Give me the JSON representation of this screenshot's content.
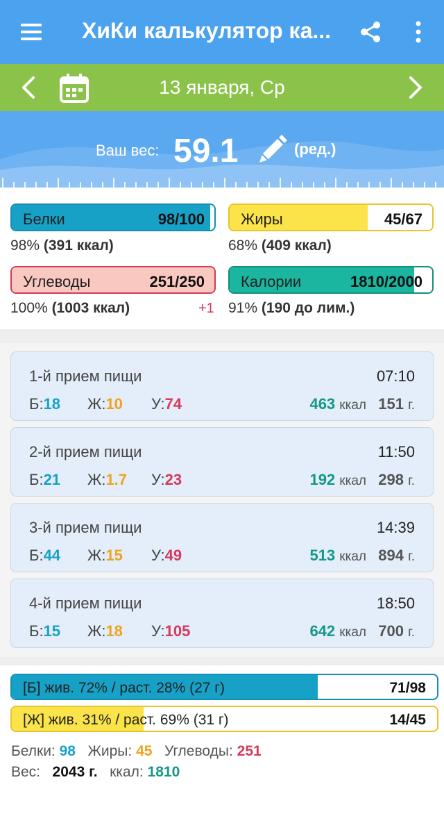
{
  "app": {
    "title": "ХиКи калькулятор ка...",
    "icons": {
      "menu": "hamburger-menu-icon",
      "share": "share-icon",
      "more": "more-vertical-icon"
    }
  },
  "datebar": {
    "date": "13 января, Ср",
    "icons": {
      "prev": "chevron-left-icon",
      "calendar": "calendar-icon",
      "next": "chevron-right-icon"
    }
  },
  "weight": {
    "label": "Ваш вес:",
    "value": "59.1",
    "edit_label": "(ред.)",
    "icon": "pencil-icon"
  },
  "nutrients": {
    "protein": {
      "label": "Белки",
      "value": "98/100",
      "sub_pct": "98%",
      "sub_kcal": "(391 ккал)",
      "fill_fraction": 0.98,
      "color": "#17a1c7"
    },
    "fat": {
      "label": "Жиры",
      "value": "45/67",
      "sub_pct": "68%",
      "sub_kcal": "(409 ккал)",
      "fill_fraction": 0.68,
      "color": "#fbe34a"
    },
    "carbs": {
      "label": "Углеводы",
      "value": "251/250",
      "sub_pct": "100%",
      "sub_kcal": "(1003 ккал)",
      "over": "+1",
      "fill_fraction": 1.0,
      "color": "#f9c8c0"
    },
    "calories": {
      "label": "Калории",
      "value": "1810/2000",
      "sub_pct": "91%",
      "sub_kcal": "(190 до лим.)",
      "fill_fraction": 0.91,
      "color": "#1ab6a0"
    }
  },
  "meals": [
    {
      "title": "1-й прием пищи",
      "time": "07:10",
      "b_label": "Б:",
      "b": "18",
      "z_label": "Ж:",
      "z": "10",
      "u_label": "У:",
      "u": "74",
      "kcal": "463",
      "kcal_unit": "ккал",
      "grams": "151",
      "grams_unit": "г."
    },
    {
      "title": "2-й прием пищи",
      "time": "11:50",
      "b_label": "Б:",
      "b": "21",
      "z_label": "Ж:",
      "z": "1.7",
      "u_label": "У:",
      "u": "23",
      "kcal": "192",
      "kcal_unit": "ккал",
      "grams": "298",
      "grams_unit": "г."
    },
    {
      "title": "3-й прием пищи",
      "time": "14:39",
      "b_label": "Б:",
      "b": "44",
      "z_label": "Ж:",
      "z": "15",
      "u_label": "У:",
      "u": "49",
      "kcal": "513",
      "kcal_unit": "ккал",
      "grams": "894",
      "grams_unit": "г."
    },
    {
      "title": "4-й прием пищи",
      "time": "18:50",
      "b_label": "Б:",
      "b": "15",
      "z_label": "Ж:",
      "z": "18",
      "u_label": "У:",
      "u": "105",
      "kcal": "642",
      "kcal_unit": "ккал",
      "grams": "700",
      "grams_unit": "г."
    }
  ],
  "sources": {
    "protein": {
      "label": "[Б] жив. 72% / раст. 28% (27 г)",
      "value": "71/98",
      "fill_fraction": 0.72,
      "color": "#17a1c7"
    },
    "fat": {
      "label": "[Ж] жив. 31% / раст. 69% (31 г)",
      "value": "14/45",
      "fill_fraction": 0.31,
      "color": "#fbe34a"
    }
  },
  "totals": {
    "protein_label": "Белки:",
    "protein": "98",
    "fat_label": "Жиры:",
    "fat": "45",
    "carbs_label": "Углеводы:",
    "carbs": "251",
    "weight_label": "Вес:",
    "weight": "2043 г.",
    "kcal_label": "ккал:",
    "kcal": "1810"
  }
}
